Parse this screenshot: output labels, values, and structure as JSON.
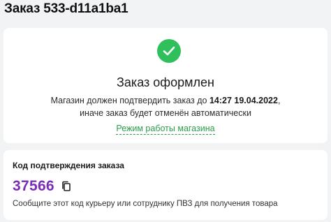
{
  "order": {
    "title": "Заказ 533-d11a1ba1"
  },
  "status": {
    "icon": "check-circle-icon",
    "heading": "Заказ оформлен",
    "text_before": "Магазин должен подтвердить заказ до ",
    "deadline": "14:27 19.04.2022",
    "text_after": ",",
    "text_line2": "иначе заказ будет отменён автоматически",
    "shop_hours_link": "Режим работы магазина"
  },
  "confirmation": {
    "heading": "Код подтверждения заказа",
    "code": "37566",
    "copy_icon": "copy-icon",
    "hint": "Сообщите этот код курьеру или сотруднику ПВЗ для получения товара"
  },
  "colors": {
    "success": "#2fbf5b",
    "link": "#2a9d4a",
    "code": "#7b2db5",
    "background": "#f2f3f5"
  }
}
